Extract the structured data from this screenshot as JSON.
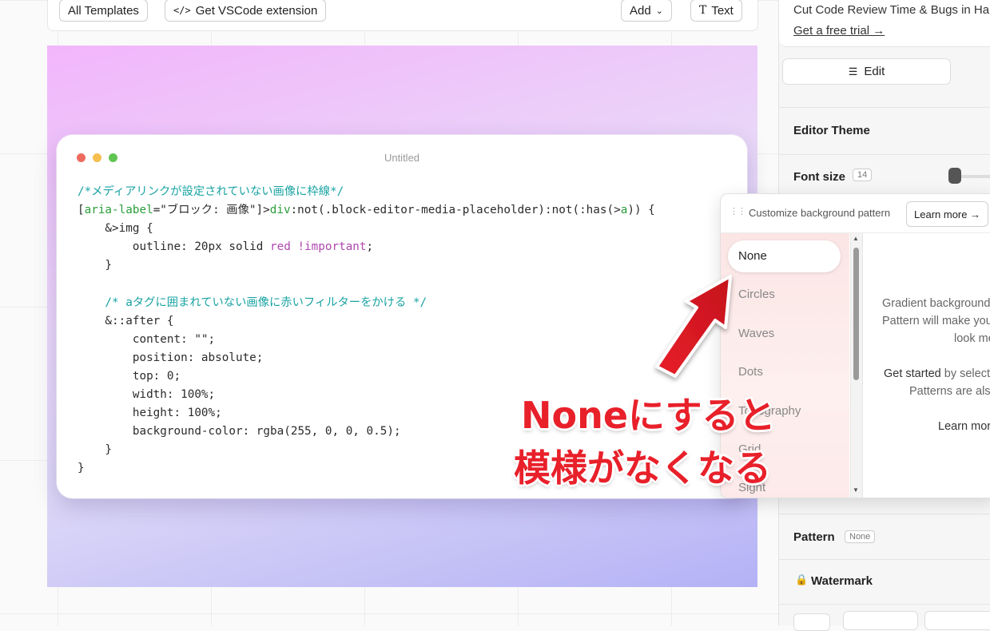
{
  "toolbar": {
    "all_templates": "All Templates",
    "vscode": "Get VSCode extension",
    "add": "Add",
    "text": "Text"
  },
  "editor_window": {
    "title": "Untitled",
    "code_lines": [
      [
        {
          "t": "/*メディアリンクが設定されていない画像に枠線*/",
          "c": "cm"
        }
      ],
      [
        {
          "t": "[",
          "c": ""
        },
        {
          "t": "aria-label",
          "c": "at"
        },
        {
          "t": "=\"ブロック: 画像\"]>",
          "c": ""
        },
        {
          "t": "div",
          "c": "kw"
        },
        {
          "t": ":not(.block-editor-media-placeholder):not(:has(>",
          "c": ""
        },
        {
          "t": "a",
          "c": "kw"
        },
        {
          "t": ")) {",
          "c": ""
        }
      ],
      [
        {
          "t": "    &>img {",
          "c": ""
        }
      ],
      [
        {
          "t": "        outline: 20px solid ",
          "c": ""
        },
        {
          "t": "red !important",
          "c": "pk"
        },
        {
          "t": ";",
          "c": ""
        }
      ],
      [
        {
          "t": "    }",
          "c": ""
        }
      ],
      [
        {
          "t": "",
          "c": ""
        }
      ],
      [
        {
          "t": "    /* aタグに囲まれていない画像に赤いフィルターをかける */",
          "c": "cm"
        }
      ],
      [
        {
          "t": "    &::after {",
          "c": ""
        }
      ],
      [
        {
          "t": "        content: \"\";",
          "c": ""
        }
      ],
      [
        {
          "t": "        position: absolute;",
          "c": ""
        }
      ],
      [
        {
          "t": "        top: 0;",
          "c": ""
        }
      ],
      [
        {
          "t": "        width: 100%;",
          "c": ""
        }
      ],
      [
        {
          "t": "        height: 100%;",
          "c": ""
        }
      ],
      [
        {
          "t": "        background-color: rgba(255, 0, 0, 0.5);",
          "c": ""
        }
      ],
      [
        {
          "t": "    }",
          "c": ""
        }
      ],
      [
        {
          "t": "}",
          "c": ""
        }
      ]
    ]
  },
  "sidebar": {
    "promo_text": "Cut Code Review Time & Bugs in Half",
    "promo_link": "Get a free trial →",
    "edit_button": "Edit",
    "editor_theme": "Editor Theme",
    "font_size_label": "Font size",
    "font_size_value": "14",
    "pattern_label": "Pattern",
    "pattern_value": "None",
    "watermark_label": "Watermark"
  },
  "pattern_popup": {
    "title": "Customize background pattern",
    "learn_more": "Learn more →",
    "options": [
      "None",
      "Circles",
      "Waves",
      "Dots",
      "Topography",
      "Grid",
      "Sight"
    ],
    "selected": "None",
    "description_1": "Gradient backgrounds",
    "description_2": "Pattern will make your",
    "description_3": "look more",
    "get_started_bold": "Get started",
    "get_started_rest": "by selecting",
    "patterns_text": "Patterns are also",
    "learn_more_2": "Learn more"
  },
  "annotation": {
    "line1": "Noneにすると",
    "line2": "模様がなくなる",
    "color": "#e8202a"
  }
}
